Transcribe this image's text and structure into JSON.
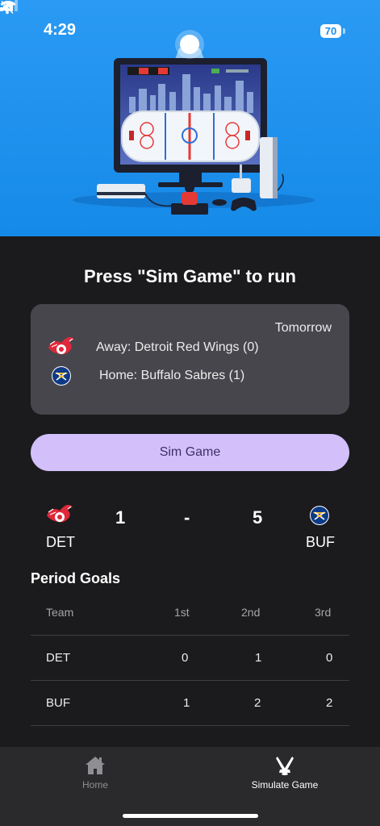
{
  "status": {
    "time": "4:29",
    "battery": "70"
  },
  "page_title": "Press \"Sim Game\" to run",
  "game": {
    "date": "Tomorrow",
    "away": "Away: Detroit Red Wings (0)",
    "home": "Home: Buffalo Sabres (1)"
  },
  "sim_button": "Sim Game",
  "result": {
    "away_abbr": "DET",
    "home_abbr": "BUF",
    "away_score": "1",
    "separator": "-",
    "home_score": "5"
  },
  "period_goals": {
    "title": "Period Goals",
    "headers": [
      "Team",
      "1st",
      "2nd",
      "3rd"
    ],
    "rows": [
      {
        "team": "DET",
        "p1": "0",
        "p2": "1",
        "p3": "0"
      },
      {
        "team": "BUF",
        "p1": "1",
        "p2": "2",
        "p3": "2"
      }
    ]
  },
  "tabs": [
    {
      "label": "Home",
      "icon": "house-icon",
      "active": false
    },
    {
      "label": "Simulate Game",
      "icon": "hockey-sticks-icon",
      "active": true
    }
  ],
  "colors": {
    "hero_bg": "#1e8ff0",
    "page_bg": "#1b1b1d",
    "card_bg": "#48464d",
    "button_bg": "#d3c0fb",
    "red_wings": "#ce1126",
    "sabres": "#003087"
  }
}
